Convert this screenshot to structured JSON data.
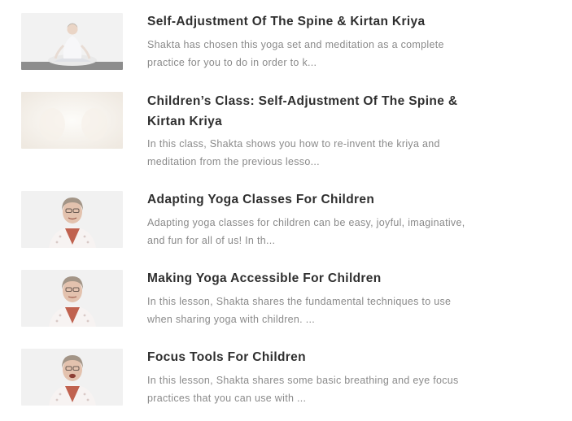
{
  "lessons": [
    {
      "title": "Self-Adjustment Of The Spine & Kirtan Kriya",
      "excerpt": "Shakta has chosen this yoga set and meditation as a complete practice for you to do in order to k...",
      "thumbnail_icon": "meditation-pose-thumbnail"
    },
    {
      "title": "Children’s Class: Self-Adjustment Of The Spine & Kirtan Kriya",
      "excerpt": "In this class, Shakta shows you how to re-invent the kriya and meditation from the previous lesso...",
      "thumbnail_icon": "faded-light-thumbnail"
    },
    {
      "title": "Adapting Yoga Classes For Children",
      "excerpt": "Adapting yoga classes for children can be easy, joyful, imaginative, and fun for all of us! In th...",
      "thumbnail_icon": "instructor-portrait-thumbnail"
    },
    {
      "title": "Making Yoga Accessible For Children",
      "excerpt": "In this lesson, Shakta shares the fundamental techniques to use when sharing yoga with children. ...",
      "thumbnail_icon": "instructor-portrait-thumbnail"
    },
    {
      "title": "Focus Tools For Children",
      "excerpt": "In this lesson, Shakta shares some basic breathing and eye focus practices that you can use with ...",
      "thumbnail_icon": "instructor-portrait-thumbnail"
    }
  ],
  "colors": {
    "title": "#2f2f2f",
    "excerpt": "#8a8a8a",
    "background": "#ffffff"
  }
}
